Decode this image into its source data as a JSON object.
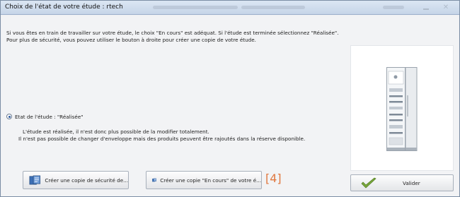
{
  "window": {
    "title": "Choix de l'état de votre étude : rtech"
  },
  "intro": {
    "line1": "Si vous êtes en train de travailler sur votre étude, le choix \"En cours\" est adéquat. Si l'étude est terminée sélectionnez \"Réalisée\".",
    "line2": "Pour plus de sécurité, vous pouvez utiliser le bouton à droite pour créer une copie de votre étude."
  },
  "state": {
    "radio_label": "Etat de l'étude : \"Réalisée\"",
    "selected": true,
    "desc1": "L'étude est réalisée, il n'est donc plus possible de la modifier totalement.",
    "desc2": "Il n'est pas possible de changer d'enveloppe mais des produits peuvent être rajoutés dans la réserve disponible."
  },
  "buttons": {
    "copy_security": "Créer une copie de sécurité de...",
    "copy_en_cours": "Créer une copie \"En cours\" de votre é...",
    "validate": "Valider"
  },
  "annotation": "[4]",
  "icons": {
    "copy": "copy-document-icon",
    "validate": "checkmark-icon",
    "minimize": "minimize-icon",
    "close": "close-icon"
  },
  "colors": {
    "titlebar": "#c6d5e8",
    "annotation": "#e07840",
    "checkmark": "#7aa83c"
  }
}
